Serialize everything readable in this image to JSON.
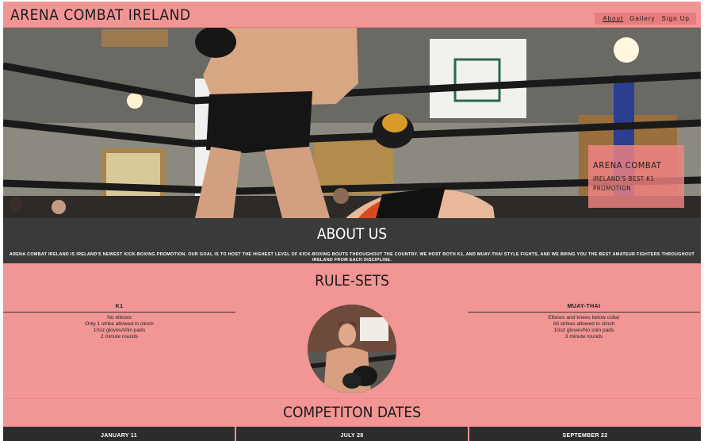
{
  "header": {
    "brand": "ARENA COMBAT IRELAND",
    "nav": [
      "About",
      "Gallery",
      "Sign Up"
    ]
  },
  "hero": {
    "title": "ARENA COMBAT",
    "subtitle": "IRELAND'S BEST K1 PROMOTION"
  },
  "about": {
    "heading": "ABOUT US",
    "text": "ARENA COMBAT IRELAND IS IRELAND'S NEWEST KICK-BOXING PROMOTION. OUR GOAL IS TO HOST THE HIGHEST LEVEL OF KICK-BOXING BOUTS THROUGHOUT THE COUNTRY. WE HOST BOTH K1, AND MUAY-THAI STYLE FIGHTS, AND WE BRING YOU THE BEST AMATEUR FIGHTERS THROUGHOUT IRELAND FROM EACH DISCIPLINE."
  },
  "rules": {
    "heading": "RULE-SETS",
    "k1": {
      "title": "K1",
      "items": [
        "No elbows",
        "Only 1 strike allowed in clinch",
        "10oz gloves/shin pads",
        "2 minute rounds"
      ]
    },
    "muay_thai": {
      "title": "MUAY-THAI",
      "items": [
        "Elbows and knees below collar",
        "All strikes allowed in clinch",
        "10oz gloves/No shin pads",
        "3 minute rounds"
      ]
    }
  },
  "dates": {
    "heading": "COMPETITON DATES",
    "items": [
      "JANUARY 11",
      "JULY 28",
      "SEPTEMBER 22"
    ]
  },
  "colors": {
    "accent": "#f29595",
    "dark": "#3a3a3a"
  }
}
